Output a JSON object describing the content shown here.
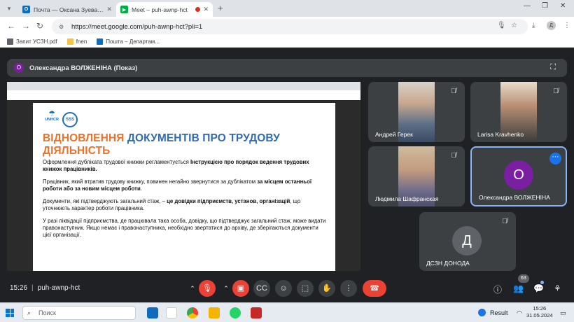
{
  "browser": {
    "tabs": [
      {
        "title": "Почта — Оксана Зуева — Outl",
        "active": false
      },
      {
        "title": "Meet – puh-awnp-hct",
        "active": true
      }
    ],
    "url": "https://meet.google.com/puh-awnp-hct?pli=1",
    "profile_initial": "Д",
    "bookmarks": [
      "Запит УСЗН.pdf",
      "fnen",
      "Пошта – Департам..."
    ]
  },
  "meet": {
    "presenter_initial": "О",
    "presenter_label": "Олександра ВОЛЖЕНІНА (Показ)",
    "meeting_time": "15:26",
    "meeting_code": "puh-awnp-hct",
    "participants_count": "63",
    "participants": [
      {
        "name": "Андрей Герек",
        "muted": true
      },
      {
        "name": "Larisa Kravhenko",
        "muted": true
      },
      {
        "name": "Людмила Шафранская",
        "muted": true
      },
      {
        "name": "Олександра ВОЛЖЕНІНА",
        "initial": "О",
        "avatar_color": "#7b1fa2",
        "muted": false
      },
      {
        "name": "ДСЗН ДОНОДА",
        "initial": "Д",
        "avatar_color": "#5f6368",
        "muted": true
      }
    ]
  },
  "slide": {
    "logo_unhcr": "UNHCR",
    "logo_sss": "SSS",
    "title_orange": "ВІДНОВЛЕННЯ",
    "title_blue_1": "ДОКУМЕНТІВ ПРО ТРУДОВУ",
    "title_blue_2": "ДІЯЛЬНІСТЬ",
    "p1_a": "Оформлення дубліката трудової книжки регламентується ",
    "p1_b": "Інструкцією про порядок ведення трудових книжок працівників.",
    "p2_a": "Працівник, який втратив трудову книжку, повинен негайно звернутися за дублікатом ",
    "p2_b": "за місцем останньої роботи або за новим місцем роботи",
    "p2_c": ".",
    "p3_a": "Документи, які підтверджують загальний стаж, – ",
    "p3_b": "це довідки підприємств, установ, організацій",
    "p3_c": ", що уточнюють характер роботи працівника.",
    "p4": "У разі ліквідації підприємства, де працювала така особа, довідку, що підтверджує загальний стаж, може видати правонаступник. Якщо немає і правонаступника, необхідно звертатися до архіву, де зберігаються документи цієї організації."
  },
  "taskbar": {
    "search_placeholder": "Поиск",
    "weather": "Result",
    "time": "15:26",
    "date": "31.05.2024"
  },
  "colors": {
    "meet_bg": "#202124",
    "tile_bg": "#3c4043",
    "end_call": "#ea4335",
    "title_orange": "#e8732a",
    "title_blue": "#2f6bb0"
  }
}
